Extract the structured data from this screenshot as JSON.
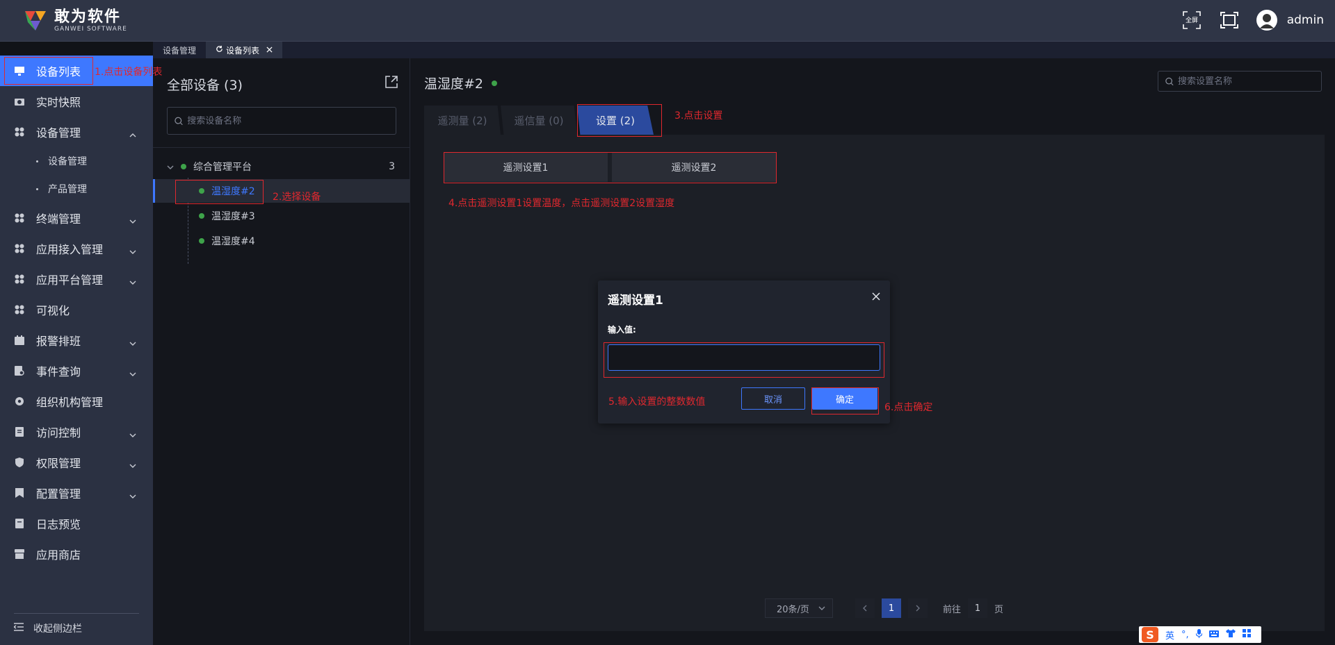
{
  "brand": {
    "name_cn": "敢为软件",
    "name_en": "GANWEI  SOFTWARE"
  },
  "topbar": {
    "fullscreen_label": "全屏",
    "username": "admin"
  },
  "tabs": [
    {
      "label": "设备管理"
    },
    {
      "label": "设备列表"
    }
  ],
  "sidebar": {
    "items": [
      {
        "label": "设备列表",
        "icon": "monitor-icon"
      },
      {
        "label": "实时快照",
        "icon": "camera-icon"
      },
      {
        "label": "设备管理",
        "icon": "grid-icon"
      },
      {
        "label": "终端管理",
        "icon": "grid-icon"
      },
      {
        "label": "应用接入管理",
        "icon": "grid-icon"
      },
      {
        "label": "应用平台管理",
        "icon": "grid-icon"
      },
      {
        "label": "可视化",
        "icon": "grid-icon"
      },
      {
        "label": "报警排班",
        "icon": "calendar-icon"
      },
      {
        "label": "事件查询",
        "icon": "document-search-icon"
      },
      {
        "label": "组织机构管理",
        "icon": "gear-icon"
      },
      {
        "label": "访问控制",
        "icon": "document-icon"
      },
      {
        "label": "权限管理",
        "icon": "shield-icon"
      },
      {
        "label": "配置管理",
        "icon": "bookmark-icon"
      },
      {
        "label": "日志预览",
        "icon": "log-icon"
      },
      {
        "label": "应用商店",
        "icon": "store-icon"
      }
    ],
    "subitems": [
      {
        "label": "设备管理"
      },
      {
        "label": "产品管理"
      }
    ],
    "collapse_label": "收起侧边栏"
  },
  "devices": {
    "title": "全部设备 (3)",
    "search_placeholder": "搜索设备名称",
    "root_label": "综合管理平台",
    "root_count": "3",
    "nodes": [
      {
        "label": "温湿度#2"
      },
      {
        "label": "温湿度#3"
      },
      {
        "label": "温湿度#4"
      }
    ]
  },
  "content": {
    "title": "温湿度#2",
    "search_placeholder": "搜索设置名称",
    "subtabs": [
      {
        "label": "遥测量 (2)"
      },
      {
        "label": "遥信量 (0)"
      },
      {
        "label": "设置 (2)"
      }
    ],
    "settings": [
      {
        "label": "遥测设置1"
      },
      {
        "label": "遥测设置2"
      }
    ]
  },
  "pagination": {
    "page_size": "20条/页",
    "current_page": "1",
    "goto_prefix": "前往",
    "goto_value": "1",
    "goto_suffix": "页"
  },
  "modal": {
    "title": "遥测设置1",
    "label": "输入值:",
    "input_value": "",
    "cancel_label": "取消",
    "ok_label": "确定"
  },
  "annotations": {
    "step1": "1.点击设备列表",
    "step2": "2.选择设备",
    "step3": "3.点击设置",
    "step4": "4.点击遥测设置1设置温度，点击遥测设置2设置湿度",
    "step5": "5.输入设置的整数数值",
    "step6": "6.点击确定"
  },
  "ime": {
    "lang": "英",
    "punct": "°,"
  },
  "colors": {
    "accent": "#3e78ff",
    "annotation": "#e0282e",
    "online": "#3ea34a",
    "sidebar_bg": "#2b3142",
    "topbar_bg": "#2f3546"
  }
}
